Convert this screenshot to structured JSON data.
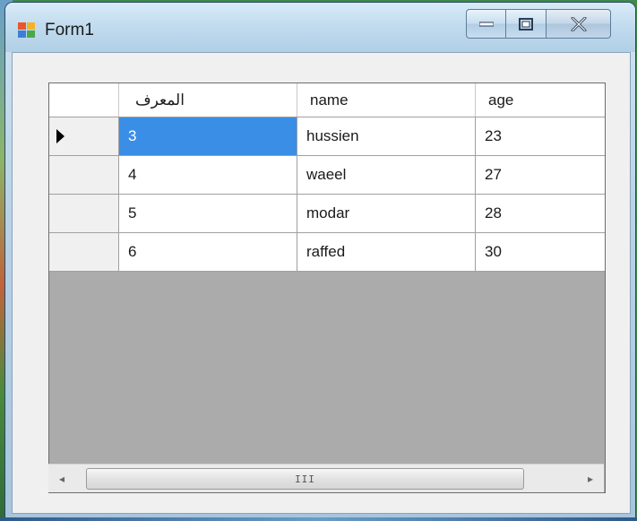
{
  "window": {
    "title": "Form1"
  },
  "grid": {
    "columns": [
      "المعرف",
      "name",
      "age"
    ],
    "rows": [
      {
        "id": "3",
        "name": "hussien",
        "age": "23"
      },
      {
        "id": "4",
        "name": "waeel",
        "age": "27"
      },
      {
        "id": "5",
        "name": "modar",
        "age": "28"
      },
      {
        "id": "6",
        "name": "raffed",
        "age": "30"
      }
    ],
    "current_row_index": 0,
    "selected_cell": "id"
  },
  "scrollbar": {
    "thumb_grip": "III"
  },
  "colors": {
    "selection": "#3a8ee6",
    "grid_background": "#ababab"
  }
}
